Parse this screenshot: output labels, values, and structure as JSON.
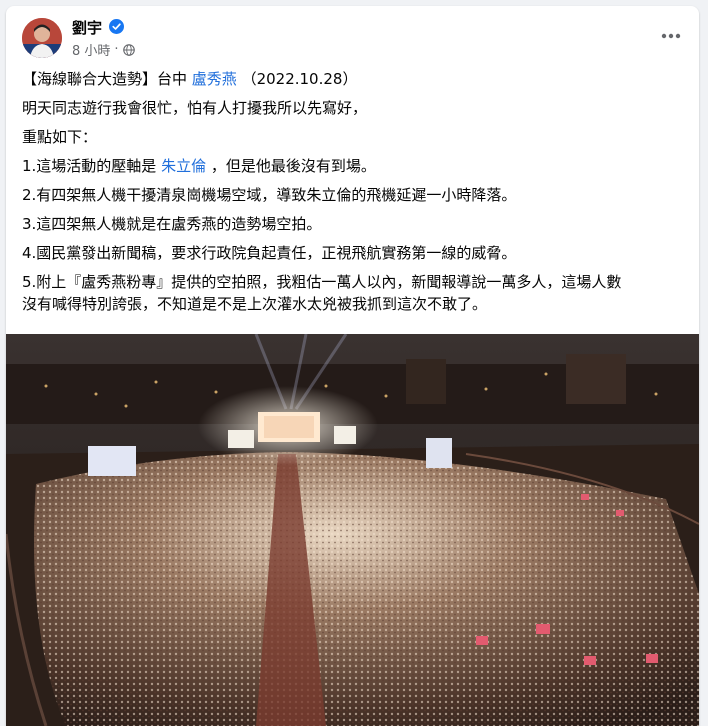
{
  "post": {
    "author": "劉宇",
    "time": "8 小時",
    "separator": "·",
    "lines": {
      "l1": {
        "a": "【海線聯合大造勢】台中 ",
        "link": "盧秀燕",
        "b": " （2022.10.28）"
      },
      "l2": "明天同志遊行我會很忙，怕有人打擾我所以先寫好，",
      "l3": "重點如下：",
      "l4": {
        "a": "1.這場活動的壓軸是 ",
        "link": "朱立倫",
        "b": " ，但是他最後沒有到場。"
      },
      "l5": "2.有四架無人機干擾清泉崗機場空域，導致朱立倫的飛機延遲一小時降落。",
      "l6": "3.這四架無人機就是在盧秀燕的造勢場空拍。",
      "l7": "4.國民黨發出新聞稿，要求行政院負起責任，正視飛航實務第一線的威脅。",
      "l8": "5.附上『盧秀燕粉專』提供的空拍照，我粗估一萬人以內，新聞報導說一萬多人，這場人數",
      "l9": "沒有喊得特別誇張，不知道是不是上次灌水太兇被我抓到這次不敢了。"
    },
    "colors": {
      "link": "#216fdb",
      "verified": "#1877f2",
      "meta": "#65676b"
    }
  }
}
